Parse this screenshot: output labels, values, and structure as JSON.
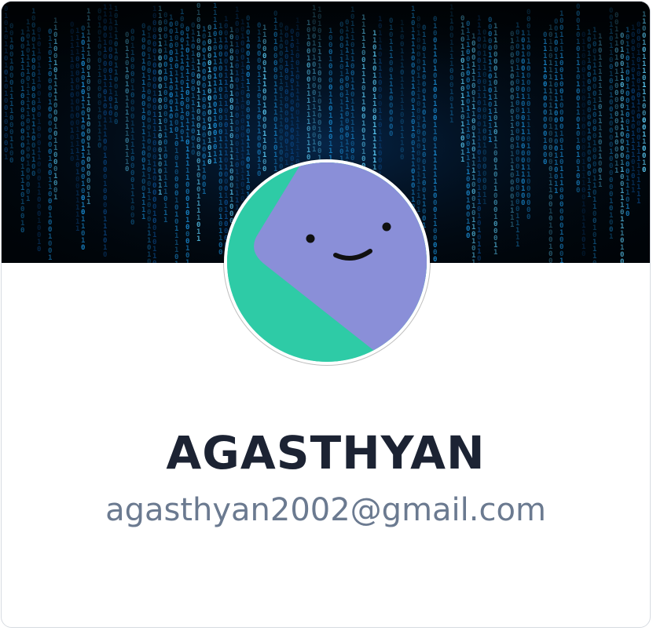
{
  "profile": {
    "name": "AGASTHYAN",
    "email": "agasthyan2002@gmail.com"
  },
  "banner": {
    "icon": "binary-code-rain-background",
    "colors": {
      "background": "#000408",
      "digits_bright": "#5fd4ff",
      "digits_mid": "#1a8fd8",
      "digits_dim": "#0a4a8a"
    }
  },
  "avatar": {
    "icon": "smiley-face-icon",
    "colors": {
      "background": "#2ecba6",
      "face": "#8a8fd8",
      "features": "#111111"
    }
  },
  "colors": {
    "name_text": "#1c2333",
    "email_text": "#6b7a90",
    "card_border": "#d7dbe1"
  }
}
